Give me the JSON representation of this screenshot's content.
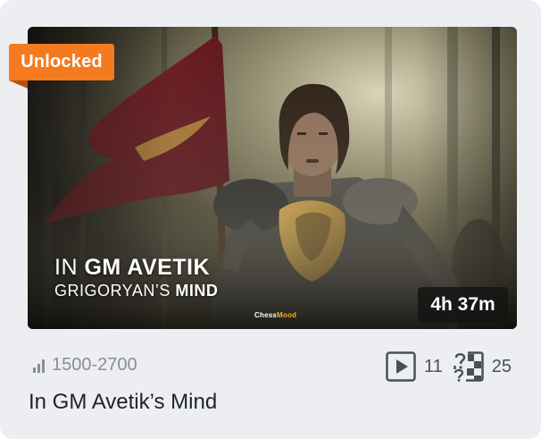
{
  "card": {
    "badge": "Unlocked",
    "thumbnail": {
      "title_line1_prefix": "IN ",
      "title_line1_bold": "GM AVETIK",
      "title_line2_prefix": "GRIGORYAN’S ",
      "title_line2_bold": "MIND",
      "logo_main": "Chess",
      "logo_accent": "Mood",
      "duration": "4h 37m"
    },
    "rating_range": "1500-2700",
    "videos_count": "11",
    "exercises_count": "25",
    "title": "In GM Avetik’s Mind",
    "icons": {
      "rating": "signal-bars-icon",
      "videos": "play-icon",
      "exercises": "chess-puzzle-icon"
    },
    "colors": {
      "badge": "#f47a1f",
      "duration_bg": "#141414",
      "card_bg": "#eceef2"
    }
  }
}
